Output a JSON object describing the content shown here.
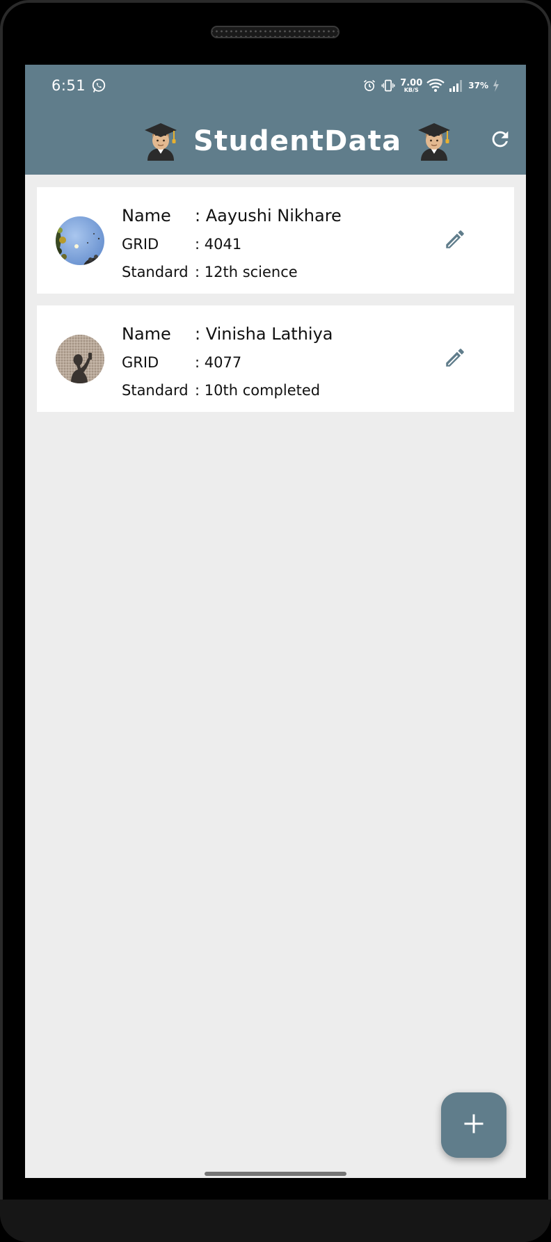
{
  "status_bar": {
    "time": "6:51",
    "net_speed_value": "7.00",
    "net_speed_unit": "KB/S",
    "battery_percent": "37%",
    "icons": [
      "whatsapp-icon",
      "alarm-icon",
      "vibrate-icon",
      "wifi-icon",
      "signal-icon",
      "battery-charging-icon"
    ]
  },
  "app_bar": {
    "title": "StudentData",
    "left_emoji": "graduate-emoji",
    "right_emoji": "graduate-emoji",
    "refresh_icon": "refresh-icon"
  },
  "field_labels": {
    "name": "Name",
    "grid": "GRID",
    "standard": "Standard"
  },
  "students": [
    {
      "name": ": Aayushi Nikhare",
      "grid": ": 4041",
      "standard": ": 12th science",
      "avatar": "avatar-photo-sky-trees"
    },
    {
      "name": ": Vinisha Lathiya",
      "grid": ": 4077",
      "standard": ": 10th completed",
      "avatar": "avatar-photo-shadow"
    }
  ],
  "fab": {
    "icon": "plus-icon"
  },
  "colors": {
    "primary": "#607d8b",
    "background": "#ededed",
    "card": "#ffffff",
    "text": "#111111"
  }
}
